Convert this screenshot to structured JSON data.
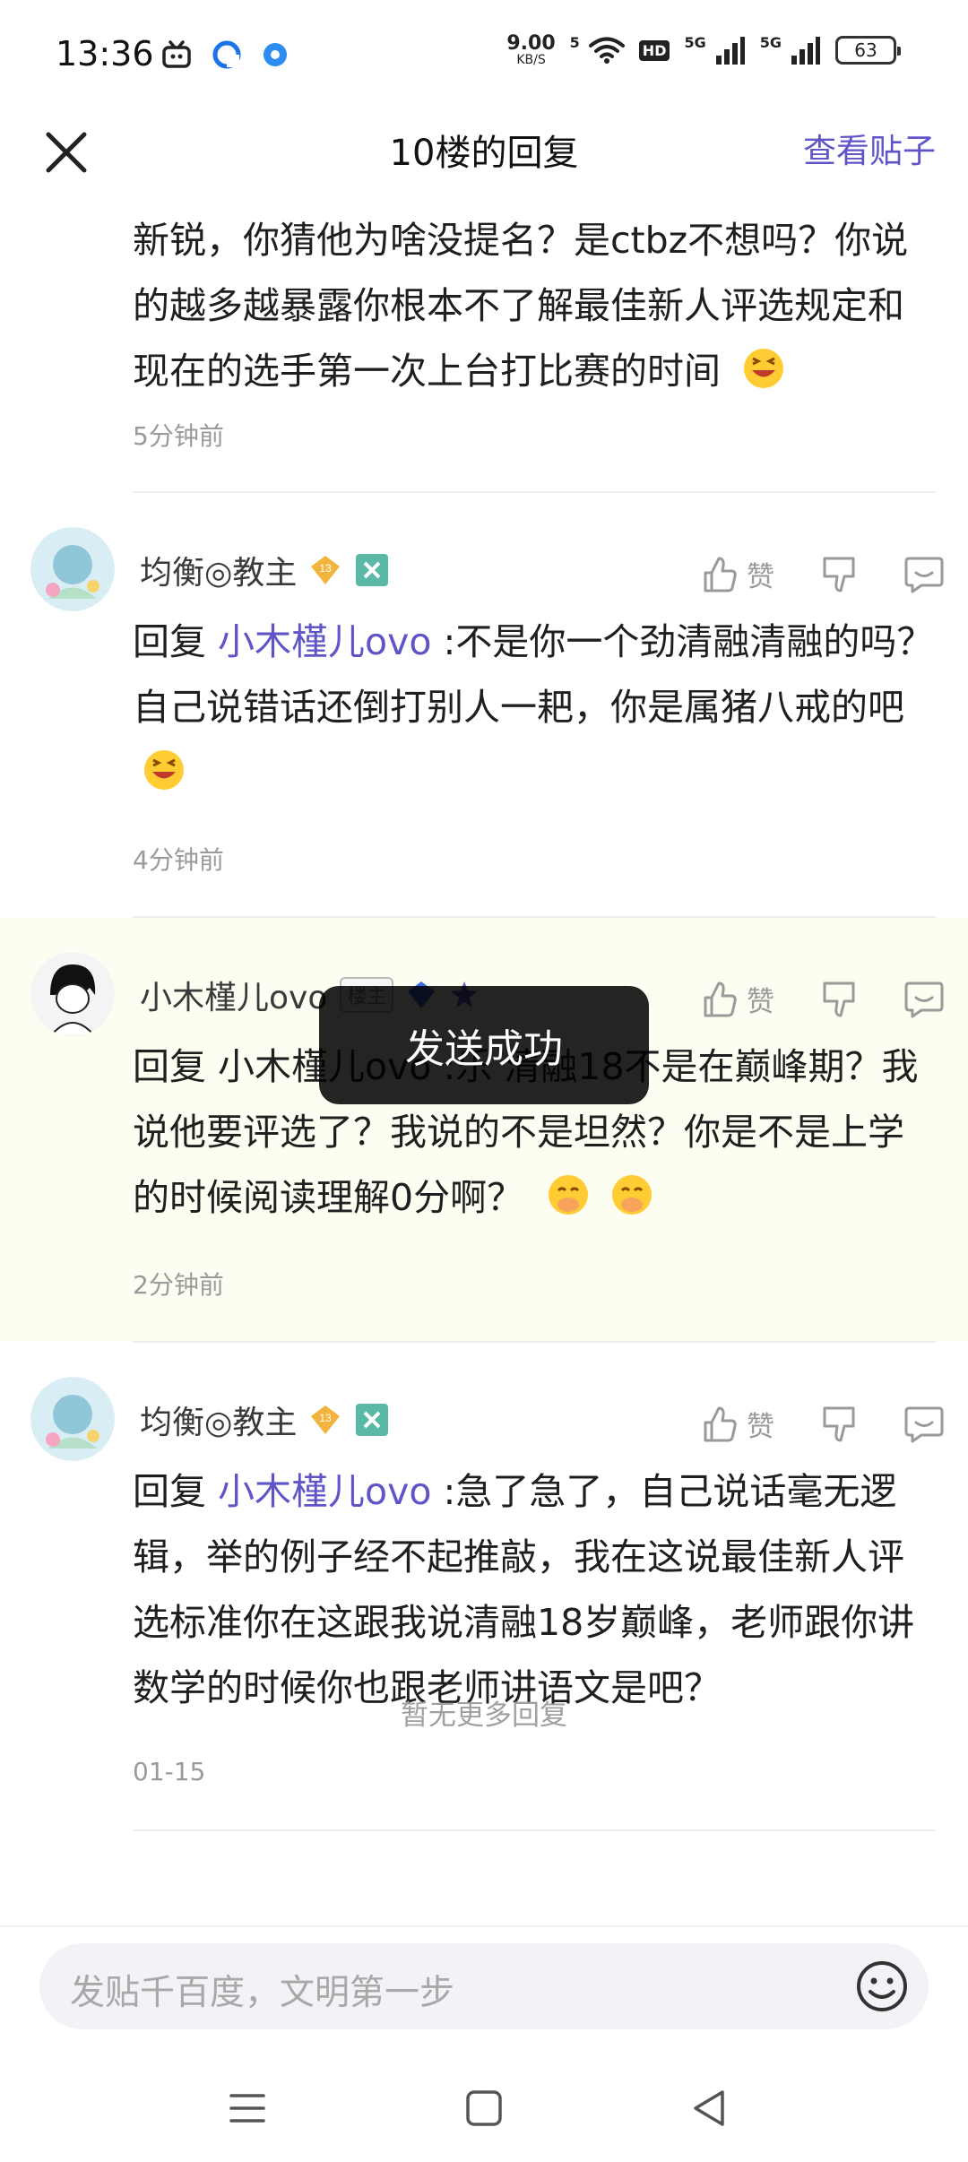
{
  "status_bar": {
    "time": "13:36",
    "net_speed_value": "9.00",
    "net_speed_unit": "KB/S",
    "wifi_label": "5",
    "hd_label": "HD",
    "signal1_label": "5G",
    "signal2_label": "5G",
    "battery": "63"
  },
  "header": {
    "title": "10楼的回复",
    "view_post": "查看贴子"
  },
  "first_reply": {
    "text": "新锐，你猜他为啥没提名？是ctbz不想吗？你说的越多越暴露你根本不了解最佳新人评选规定和现在的选手第一次上台打比赛的时间",
    "time": "5分钟前"
  },
  "replies": [
    {
      "username": "均衡◎教主",
      "level": "13",
      "like_label": "赞",
      "prefix": "回复 ",
      "mention": "小木槿儿ovo",
      "text": " :不是你一个劲清融清融的吗？自己说错话还倒打别人一耙，你是属猪八戒的吧",
      "time": "4分钟前"
    },
    {
      "username": "小木槿儿ovo",
      "host_tag": "楼主",
      "like_label": "赞",
      "prefix": "回复 ",
      "mention": "小木槿儿ovo",
      "text": " :乐 清融18不是在巅峰期？我说他要评选了？我说的不是坦然？你是不是上学的时候阅读理解0分啊？",
      "time": "2分钟前"
    },
    {
      "username": "均衡◎教主",
      "level": "13",
      "like_label": "赞",
      "prefix": "回复 ",
      "mention": "小木槿儿ovo",
      "text": " :急了急了，自己说话毫无逻辑，举的例子经不起推敲，我在这说最佳新人评选标准你在这跟我说清融18岁巅峰，老师跟你讲数学的时候你也跟老师讲语文是吧？",
      "time": "01-15"
    }
  ],
  "no_more": "暂无更多回复",
  "input": {
    "placeholder": "发贴千百度，文明第一步"
  },
  "toast": "发送成功",
  "colors": {
    "accent": "#6055c8",
    "highlight_bg": "#fdfdf2"
  }
}
